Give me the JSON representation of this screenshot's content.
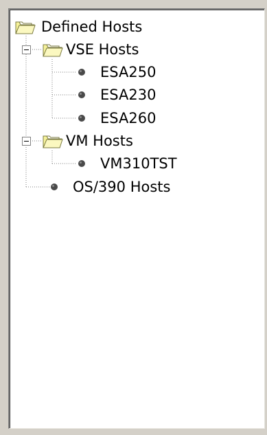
{
  "tree": {
    "root": {
      "label": "Defined Hosts",
      "icon": "folder-open-icon"
    },
    "groups": [
      {
        "label": "VSE Hosts",
        "icon": "folder-open-icon",
        "expanded": true,
        "children": [
          "ESA250",
          "ESA230",
          "ESA260"
        ]
      },
      {
        "label": "VM Hosts",
        "icon": "folder-open-icon",
        "expanded": true,
        "children": [
          "VM310TST"
        ]
      }
    ],
    "leaf": {
      "label": "OS/390 Hosts",
      "icon": "host-bullet-icon"
    }
  },
  "colors": {
    "frame_bg": "#d4d0c8",
    "panel_bg": "#ffffff",
    "folder_yellow": "#f6f29a",
    "bullet": "#4a4a4a",
    "connector": "#808080"
  }
}
